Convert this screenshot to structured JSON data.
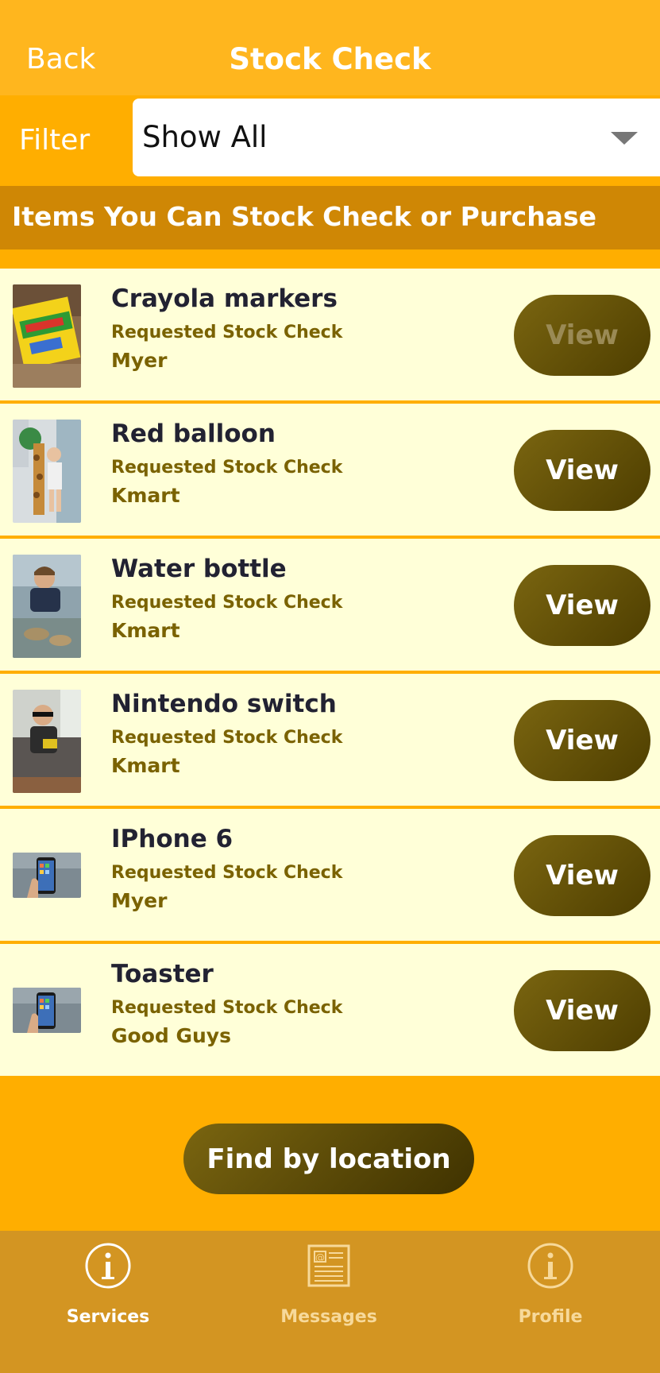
{
  "header": {
    "back_label": "Back",
    "title": "Stock Check"
  },
  "filter": {
    "label": "Filter",
    "value": "Show All"
  },
  "section": {
    "title": "Items You Can Stock Check or Purchase"
  },
  "items": [
    {
      "name": "Crayola markers",
      "status": "Requested Stock Check",
      "store": "Myer",
      "action": "View",
      "image": "crayola-markers-photo"
    },
    {
      "name": "Red balloon",
      "status": "Requested Stock Check",
      "store": "Kmart",
      "action": "View",
      "image": "child-with-giraffe-photo"
    },
    {
      "name": "Water bottle",
      "status": "Requested Stock Check",
      "store": "Kmart",
      "action": "View",
      "image": "boy-at-beach-photo"
    },
    {
      "name": "Nintendo switch",
      "status": "Requested Stock Check",
      "store": "Kmart",
      "action": "View",
      "image": "boy-with-mask-photo"
    },
    {
      "name": "IPhone 6",
      "status": "Requested Stock Check",
      "store": "Myer",
      "action": "View",
      "image": "phone-in-hand-photo"
    },
    {
      "name": "Toaster",
      "status": "Requested Stock Check",
      "store": "Good Guys",
      "action": "View",
      "image": "phone-in-hand-photo"
    }
  ],
  "find_button": {
    "label": "Find by location"
  },
  "tabs": [
    {
      "label": "Services",
      "icon": "info-icon",
      "active": true
    },
    {
      "label": "Messages",
      "icon": "newspaper-icon",
      "active": false
    },
    {
      "label": "Profile",
      "icon": "info-icon",
      "active": false
    }
  ],
  "colors": {
    "header": "#ffb61e",
    "background": "#ffae00",
    "section_bar": "#cf8705",
    "row_background": "#ffffd8",
    "button": "#5e4c05",
    "tab_bar": "#d39522"
  }
}
